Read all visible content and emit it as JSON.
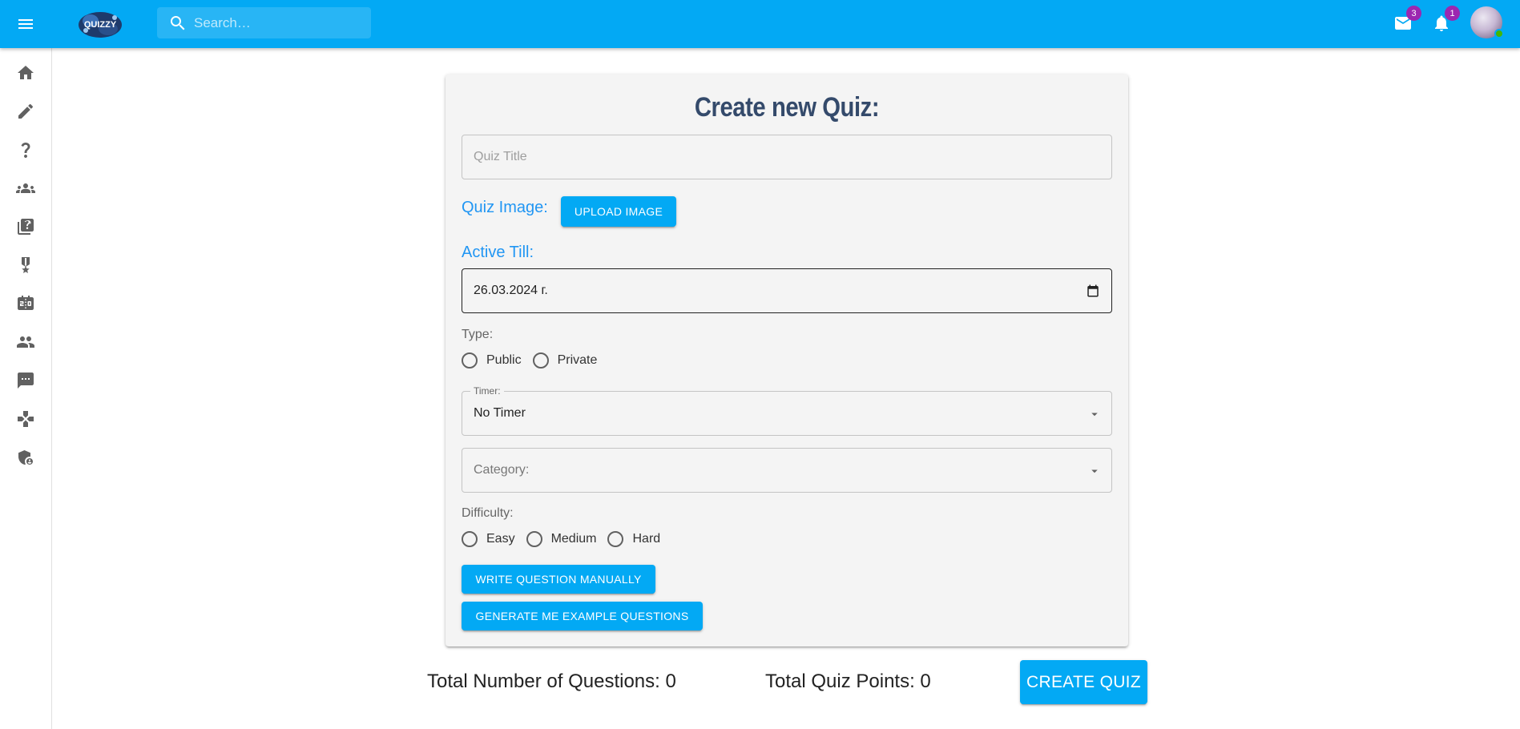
{
  "appbar": {
    "logo_text": "QUIZZY",
    "search": {
      "placeholder": "Search…",
      "value": ""
    },
    "mail_badge": "3",
    "notifications_badge": "1"
  },
  "sidebar": {
    "items": [
      {
        "icon": "home-icon"
      },
      {
        "icon": "pencil-icon"
      },
      {
        "icon": "question-mark-icon"
      },
      {
        "icon": "groups-icon"
      },
      {
        "icon": "quiz-library-icon"
      },
      {
        "icon": "trophy-icon"
      },
      {
        "icon": "scoreboard-icon"
      },
      {
        "icon": "people-icon"
      },
      {
        "icon": "chat-icon"
      },
      {
        "icon": "gamepad-icon"
      },
      {
        "icon": "admin-shield-icon"
      }
    ]
  },
  "form": {
    "title": "Create new Quiz:",
    "quiz_title_placeholder": "Quiz Title",
    "quiz_image_label": "Quiz Image:",
    "upload_image_label": "UPLOAD IMAGE",
    "active_till_label": "Active Till:",
    "active_till_value": "26.03.2024 г.",
    "type_label": "Type:",
    "type_options": [
      "Public",
      "Private"
    ],
    "timer_legend": "Timer:",
    "timer_value": "No Timer",
    "category_placeholder": "Category:",
    "difficulty_label": "Difficulty:",
    "difficulty_options": [
      "Easy",
      "Medium",
      "Hard"
    ],
    "write_manually_label": "WRITE QUESTION MANUALLY",
    "generate_label": "GENERATE ME EXAMPLE QUESTIONS"
  },
  "footer": {
    "total_questions": "Total Number of Questions: 0",
    "total_points": "Total Quiz Points: 0",
    "create_label": "CREATE QUIZ"
  },
  "colors": {
    "appbar": "#03a9f4",
    "button": "#03a9f4",
    "title": "#344a6b",
    "label_blue": "#2196f3",
    "badge": "#9c27b0",
    "online": "#44b700"
  }
}
